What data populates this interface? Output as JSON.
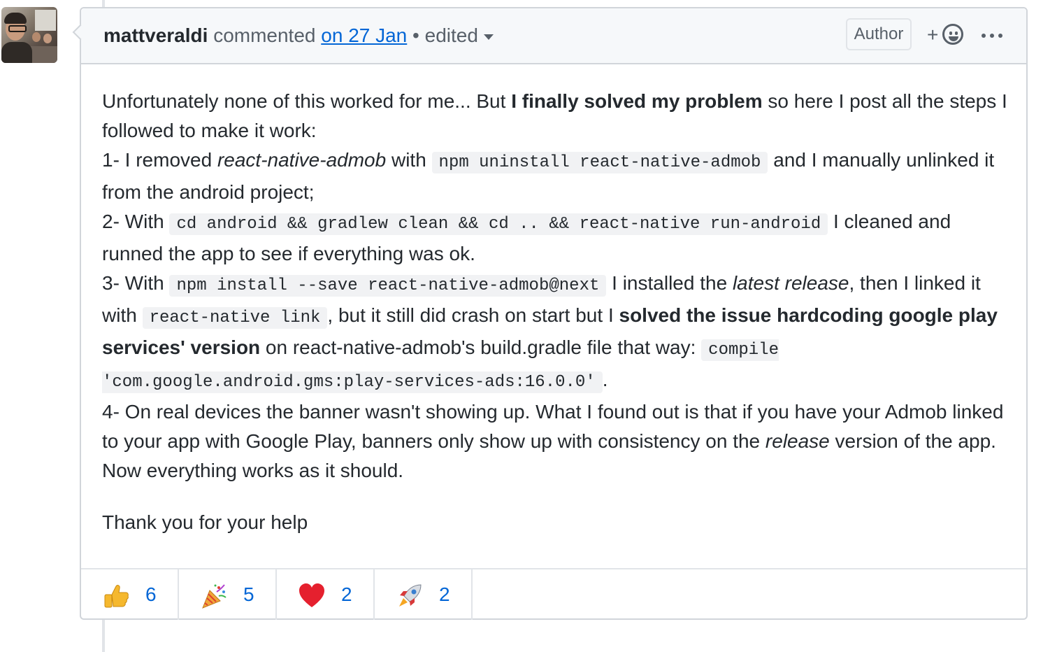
{
  "comment": {
    "author": "mattveraldi",
    "action": "commented",
    "date_link": "on 27 Jan",
    "separator": "•",
    "edited": "edited",
    "badge": "Author",
    "add_reaction": "+",
    "body": {
      "p1_a": "Unfortunately none of this worked for me... But ",
      "p1_b": "I finally solved my problem",
      "p1_c": " so here I post all the steps I followed to make it work:",
      "s1_a": "1- I removed ",
      "s1_b": "react-native-admob",
      "s1_c": " with ",
      "s1_code": "npm uninstall react-native-admob",
      "s1_d": " and I manually unlinked it from the android project;",
      "s2_a": "2- With ",
      "s2_code": "cd android && gradlew clean && cd .. && react-native run-android",
      "s2_b": " I cleaned and runned the app to see if everything was ok.",
      "s3_a": "3- With ",
      "s3_code": "npm install --save react-native-admob@next",
      "s3_b": " I installed the ",
      "s3_c": "latest release",
      "s3_d": ", then I linked it with ",
      "s3_code2": "react-native link",
      "s3_e": ", but it still did crash on start but I ",
      "s3_f": "solved the issue hardcoding google play services' version",
      "s3_g": " on react-native-admob's build.gradle file that way: ",
      "s3_code3": "compile 'com.google.android.gms:play-services-ads:16.0.0'",
      "s3_h": ".",
      "s4_a": "4- On real devices the banner wasn't showing up. What I found out is that if you have your Admob linked to your app with Google Play, banners only show up with consistency on the ",
      "s4_b": "release",
      "s4_c": " version of the app.",
      "s5": "Now everything works as it should.",
      "thanks": "Thank you for your help"
    },
    "reactions": [
      {
        "emoji": "thumbs-up",
        "count": "6"
      },
      {
        "emoji": "party-popper",
        "count": "5"
      },
      {
        "emoji": "heart",
        "count": "2"
      },
      {
        "emoji": "rocket",
        "count": "2"
      }
    ]
  }
}
